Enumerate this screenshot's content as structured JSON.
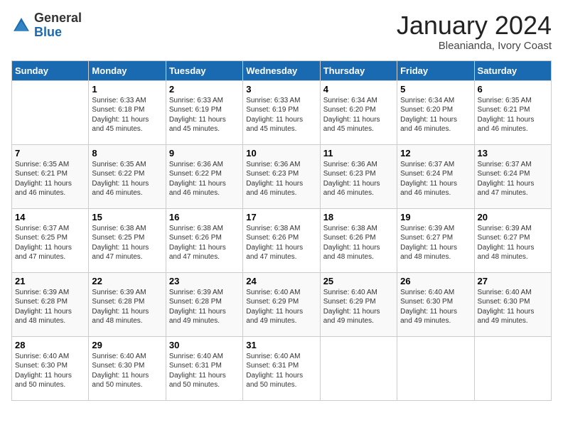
{
  "header": {
    "logo_general": "General",
    "logo_blue": "Blue",
    "month_title": "January 2024",
    "subtitle": "Bleanianda, Ivory Coast"
  },
  "days_of_week": [
    "Sunday",
    "Monday",
    "Tuesday",
    "Wednesday",
    "Thursday",
    "Friday",
    "Saturday"
  ],
  "weeks": [
    [
      {
        "day": "",
        "info": ""
      },
      {
        "day": "1",
        "info": "Sunrise: 6:33 AM\nSunset: 6:18 PM\nDaylight: 11 hours\nand 45 minutes."
      },
      {
        "day": "2",
        "info": "Sunrise: 6:33 AM\nSunset: 6:19 PM\nDaylight: 11 hours\nand 45 minutes."
      },
      {
        "day": "3",
        "info": "Sunrise: 6:33 AM\nSunset: 6:19 PM\nDaylight: 11 hours\nand 45 minutes."
      },
      {
        "day": "4",
        "info": "Sunrise: 6:34 AM\nSunset: 6:20 PM\nDaylight: 11 hours\nand 45 minutes."
      },
      {
        "day": "5",
        "info": "Sunrise: 6:34 AM\nSunset: 6:20 PM\nDaylight: 11 hours\nand 46 minutes."
      },
      {
        "day": "6",
        "info": "Sunrise: 6:35 AM\nSunset: 6:21 PM\nDaylight: 11 hours\nand 46 minutes."
      }
    ],
    [
      {
        "day": "7",
        "info": "Sunrise: 6:35 AM\nSunset: 6:21 PM\nDaylight: 11 hours\nand 46 minutes."
      },
      {
        "day": "8",
        "info": "Sunrise: 6:35 AM\nSunset: 6:22 PM\nDaylight: 11 hours\nand 46 minutes."
      },
      {
        "day": "9",
        "info": "Sunrise: 6:36 AM\nSunset: 6:22 PM\nDaylight: 11 hours\nand 46 minutes."
      },
      {
        "day": "10",
        "info": "Sunrise: 6:36 AM\nSunset: 6:23 PM\nDaylight: 11 hours\nand 46 minutes."
      },
      {
        "day": "11",
        "info": "Sunrise: 6:36 AM\nSunset: 6:23 PM\nDaylight: 11 hours\nand 46 minutes."
      },
      {
        "day": "12",
        "info": "Sunrise: 6:37 AM\nSunset: 6:24 PM\nDaylight: 11 hours\nand 46 minutes."
      },
      {
        "day": "13",
        "info": "Sunrise: 6:37 AM\nSunset: 6:24 PM\nDaylight: 11 hours\nand 47 minutes."
      }
    ],
    [
      {
        "day": "14",
        "info": "Sunrise: 6:37 AM\nSunset: 6:25 PM\nDaylight: 11 hours\nand 47 minutes."
      },
      {
        "day": "15",
        "info": "Sunrise: 6:38 AM\nSunset: 6:25 PM\nDaylight: 11 hours\nand 47 minutes."
      },
      {
        "day": "16",
        "info": "Sunrise: 6:38 AM\nSunset: 6:26 PM\nDaylight: 11 hours\nand 47 minutes."
      },
      {
        "day": "17",
        "info": "Sunrise: 6:38 AM\nSunset: 6:26 PM\nDaylight: 11 hours\nand 47 minutes."
      },
      {
        "day": "18",
        "info": "Sunrise: 6:38 AM\nSunset: 6:26 PM\nDaylight: 11 hours\nand 48 minutes."
      },
      {
        "day": "19",
        "info": "Sunrise: 6:39 AM\nSunset: 6:27 PM\nDaylight: 11 hours\nand 48 minutes."
      },
      {
        "day": "20",
        "info": "Sunrise: 6:39 AM\nSunset: 6:27 PM\nDaylight: 11 hours\nand 48 minutes."
      }
    ],
    [
      {
        "day": "21",
        "info": "Sunrise: 6:39 AM\nSunset: 6:28 PM\nDaylight: 11 hours\nand 48 minutes."
      },
      {
        "day": "22",
        "info": "Sunrise: 6:39 AM\nSunset: 6:28 PM\nDaylight: 11 hours\nand 48 minutes."
      },
      {
        "day": "23",
        "info": "Sunrise: 6:39 AM\nSunset: 6:28 PM\nDaylight: 11 hours\nand 49 minutes."
      },
      {
        "day": "24",
        "info": "Sunrise: 6:40 AM\nSunset: 6:29 PM\nDaylight: 11 hours\nand 49 minutes."
      },
      {
        "day": "25",
        "info": "Sunrise: 6:40 AM\nSunset: 6:29 PM\nDaylight: 11 hours\nand 49 minutes."
      },
      {
        "day": "26",
        "info": "Sunrise: 6:40 AM\nSunset: 6:30 PM\nDaylight: 11 hours\nand 49 minutes."
      },
      {
        "day": "27",
        "info": "Sunrise: 6:40 AM\nSunset: 6:30 PM\nDaylight: 11 hours\nand 49 minutes."
      }
    ],
    [
      {
        "day": "28",
        "info": "Sunrise: 6:40 AM\nSunset: 6:30 PM\nDaylight: 11 hours\nand 50 minutes."
      },
      {
        "day": "29",
        "info": "Sunrise: 6:40 AM\nSunset: 6:30 PM\nDaylight: 11 hours\nand 50 minutes."
      },
      {
        "day": "30",
        "info": "Sunrise: 6:40 AM\nSunset: 6:31 PM\nDaylight: 11 hours\nand 50 minutes."
      },
      {
        "day": "31",
        "info": "Sunrise: 6:40 AM\nSunset: 6:31 PM\nDaylight: 11 hours\nand 50 minutes."
      },
      {
        "day": "",
        "info": ""
      },
      {
        "day": "",
        "info": ""
      },
      {
        "day": "",
        "info": ""
      }
    ]
  ]
}
